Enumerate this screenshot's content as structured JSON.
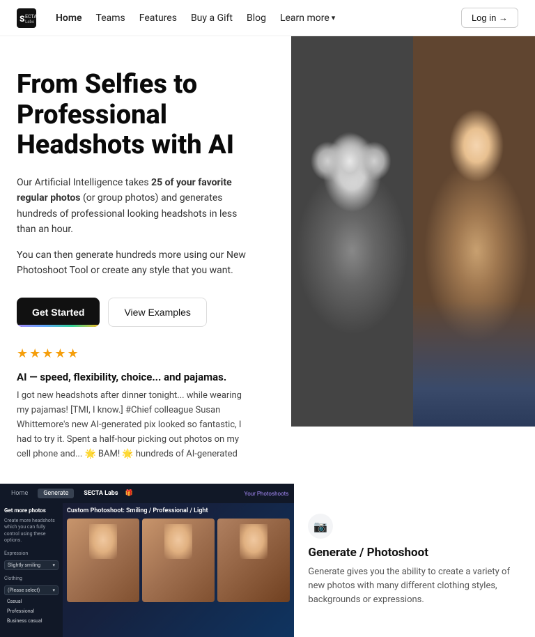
{
  "nav": {
    "logo": "SECTA",
    "logo_sub": "Labs",
    "links": [
      "Home",
      "Teams",
      "Features",
      "Buy a Gift",
      "Blog"
    ],
    "learn_more": "Learn more",
    "login": "Log in →"
  },
  "hero": {
    "title": "From Selfies to Professional Headshots with AI",
    "body1_start": "Our Artificial Intelligence takes ",
    "body1_bold": "25 of your favorite regular photos",
    "body1_end": " (or group photos) and generates hundreds of professional looking headshots in less than an hour.",
    "body2": "You can then generate hundreds more using our New Photoshoot Tool or create any style that you want.",
    "btn_primary": "Get Started",
    "btn_secondary": "View Examples",
    "stars": "★★★★★",
    "review_title": "AI — speed, flexibility, choice... and pajamas.",
    "review_text": "I got new headshots after dinner tonight... while wearing my pajamas! [TMI, I know.] #Chief colleague Susan Whittemore's new AI-generated pix looked so fantastic, I had to try it. Spent a half-hour picking out photos on my cell phone and... 🌟 BAM! 🌟 hundreds of AI-generated"
  },
  "app": {
    "tab_home": "Home",
    "tab_generate": "Generate",
    "logo": "SECTA Labs",
    "photos_link": "Your Photoshoots",
    "sidebar_title": "Get more photos",
    "sidebar_desc": "Create more headshots which you can fully control using these options.",
    "expression_label": "Expression",
    "expression_value": "Slightly smiling",
    "clothing_label": "Clothing",
    "clothing_value": "(Please select)",
    "option_casual": "Casual",
    "option_professional": "Professional",
    "option_business": "Business casual",
    "main_title": "Custom Photoshoot: Smiling / Professional / Light"
  },
  "feature": {
    "title": "Generate / Photoshoot",
    "desc": "Generate gives you the ability to create a variety of new photos with many different clothing styles, backgrounds or expressions."
  }
}
